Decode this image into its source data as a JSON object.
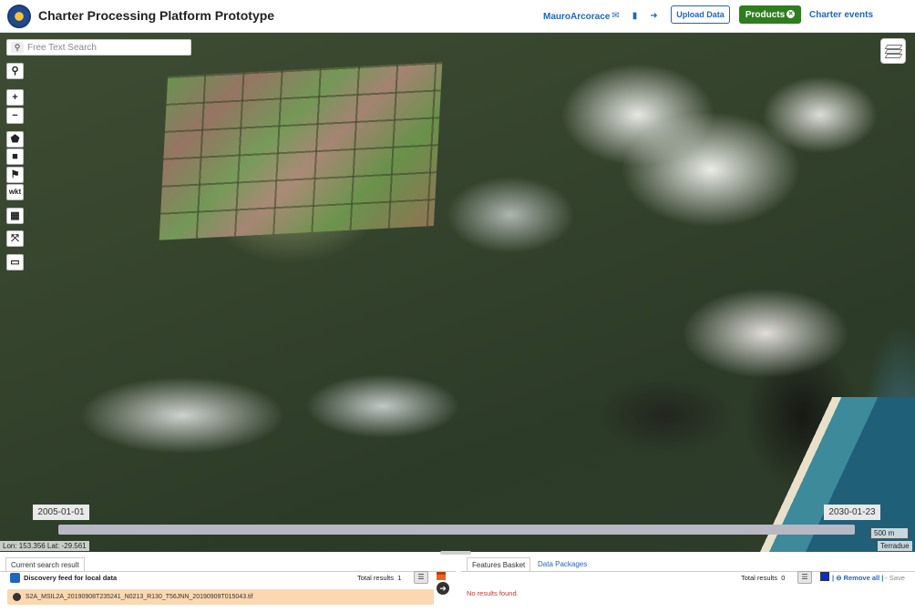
{
  "header": {
    "title": "Charter Processing Platform Prototype",
    "username": "MauroArcorace",
    "icons": [
      "envelope-icon",
      "book-icon",
      "sign-out-icon"
    ],
    "upload_label": "Upload Data",
    "products_label": "Products",
    "charter_events_label": "Charter events"
  },
  "map": {
    "search": {
      "placeholder": "Free Text Search",
      "value": ""
    },
    "tools": [
      "search-icon",
      "zoom-in-icon",
      "zoom-out-icon",
      "polygon-icon",
      "square-icon",
      "point-icon",
      "wkt",
      "gallery-icon",
      "expand-icon",
      "ruler-icon"
    ],
    "zoom_in": "+",
    "zoom_out": "−",
    "wkt_label": "wkt",
    "time_start": "2005-01-01",
    "time_end": "2030-01-23",
    "scale": "500 m",
    "coords": "Lon: 153.356 Lat: -29.561",
    "attribution": "Terradue"
  },
  "results_panel": {
    "tab_label": "Current search result",
    "feed_title": "Discovery feed for local data",
    "total_label": "Total results",
    "total_value": "1",
    "items": [
      {
        "name": "S2A_MSIL2A_20190908T235241_N0213_R130_T56JNN_20190909T015043.tif"
      }
    ]
  },
  "basket_panel": {
    "tab_features": "Features Basket",
    "tab_packages": "Data Packages",
    "total_label": "Total results",
    "total_value": "0",
    "no_results": "No results found.",
    "remove_all": "Remove all",
    "save": "Save"
  },
  "colors": {
    "accent": "#1f66c2",
    "products": "#2e7d1f",
    "result_highlight": "#fbd8b0",
    "error": "#c0392b"
  }
}
